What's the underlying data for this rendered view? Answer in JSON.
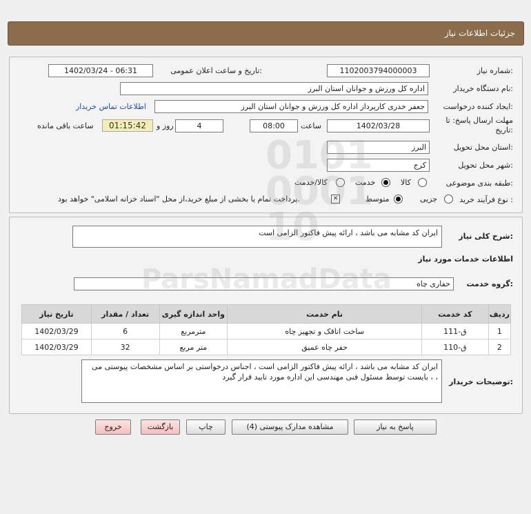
{
  "header": {
    "title": "جزئیات اطلاعات نیاز"
  },
  "info": {
    "need_number_label": "شماره نیاز:",
    "need_number": "1102003794000003",
    "announce_label": "تاریخ و ساعت اعلان عمومی:",
    "announce_value": "1402/03/24 - 06:31",
    "buyer_org_label": "نام دستگاه خریدار:",
    "buyer_org": "اداره کل ورزش و جوانان استان البرز",
    "requester_label": "ایجاد کننده درخواست:",
    "requester": "جعفر خدری کارپرداز اداره کل ورزش و جوانان استان البرز",
    "contact_link": "اطلاعات تماس خریدار",
    "deadline_label": "مهلت ارسال پاسخ: تا",
    "deadline_label2": "تاریخ:",
    "deadline_date": "1402/03/28",
    "time_label": "ساعت",
    "deadline_time": "08:00",
    "days_value": "4",
    "days_label": "روز و",
    "remaining_time": "01:15:42",
    "remaining_label": "ساعت باقی مانده",
    "province_label": "استان محل تحویل:",
    "province": "البرز",
    "city_label": "شهر محل تحویل:",
    "city": "کرج",
    "category_label": "طبقه بندی موضوعی:",
    "category_options": [
      "کالا",
      "خدمت",
      "کالا/خدمت"
    ],
    "category_selected": "خدمت",
    "process_label": "نوع فرآیند خرید :",
    "process_options": [
      "جزیی",
      "متوسط"
    ],
    "process_selected": "متوسط",
    "payment_note": "پرداخت تمام یا بخشی از مبلغ خرید،از محل \"اسناد خزانه اسلامی\" خواهد بود."
  },
  "description": {
    "summary_label": "شرح کلی نیاز:",
    "summary": "ایران کد مشابه می باشد ، ارائه پیش فاکتور الزامی است",
    "services_title": "اطلاعات خدمات مورد نیاز",
    "group_label": "گروه خدمت:",
    "group_value": "حفاری چاه",
    "table_headers": [
      "ردیف",
      "کد خدمت",
      "نام خدمت",
      "واحد اندازه گیری",
      "تعداد / مقدار",
      "تاریخ نیاز"
    ],
    "rows": [
      [
        "1",
        "ق-111",
        "ساخت اتاقک و تجهیز چاه",
        "مترمربع",
        "6",
        "1402/03/29"
      ],
      [
        "2",
        "ق-110",
        "حفر چاه عمیق",
        "متر مربع",
        "32",
        "1402/03/29"
      ]
    ],
    "buyer_notes_label": "توضیحات خریدار:",
    "buyer_notes": "ایران کد مشابه می باشد ، ارائه پیش فاکتور الزامی است ، اجناس درخواستی بر اساس مشخصات پیوستی می بایست توسط مسئول فنی مهندسی این اداره مورد تایید قرار گیرد ، ،"
  },
  "buttons": {
    "reply": "پاسخ به نیاز",
    "attachments": "مشاهده مدارک پیوستی (4)",
    "print": "چاپ",
    "back": "بازگشت",
    "exit": "خروج"
  }
}
